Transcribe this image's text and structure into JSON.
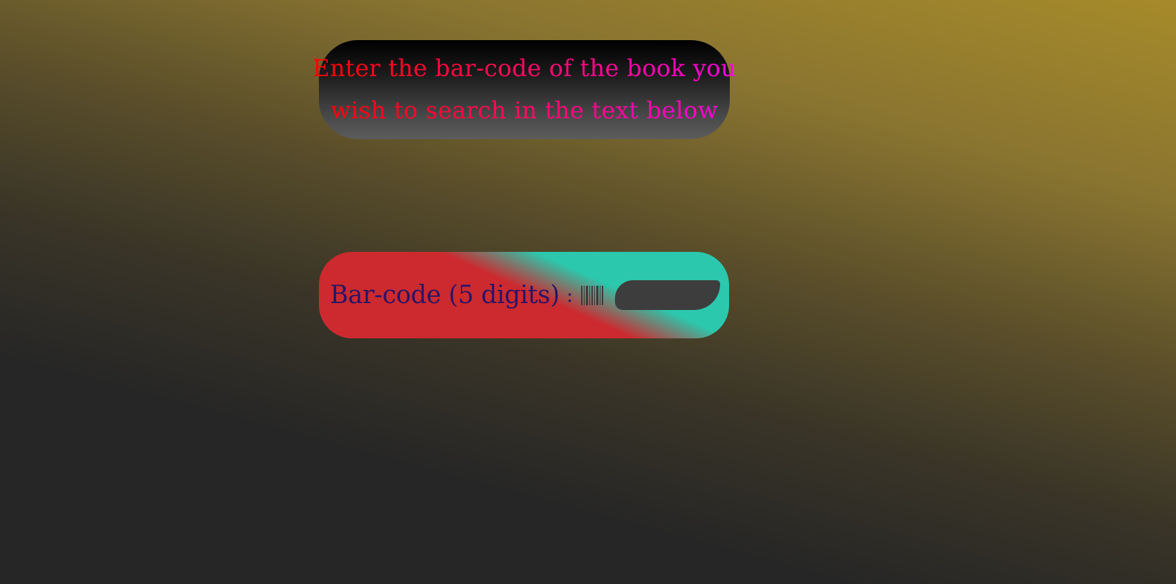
{
  "instruction": {
    "line1": "Enter the bar-code of the book you",
    "line2": "wish to search in the text below"
  },
  "barcode_form": {
    "label": "Bar-code (5 digits)",
    "separator": ":",
    "icon": "barcode-icon",
    "input_value": "",
    "input_placeholder": ""
  },
  "colors": {
    "background_top": "#a68a2a",
    "background_bottom": "#262626",
    "instruction_text_start": "#ff0000",
    "instruction_text_end": "#ff00e6",
    "form_panel_red": "#cc2a2f",
    "form_panel_teal": "#2bc8ad",
    "label_text": "#2a1566",
    "input_background": "#3d3d3d"
  }
}
